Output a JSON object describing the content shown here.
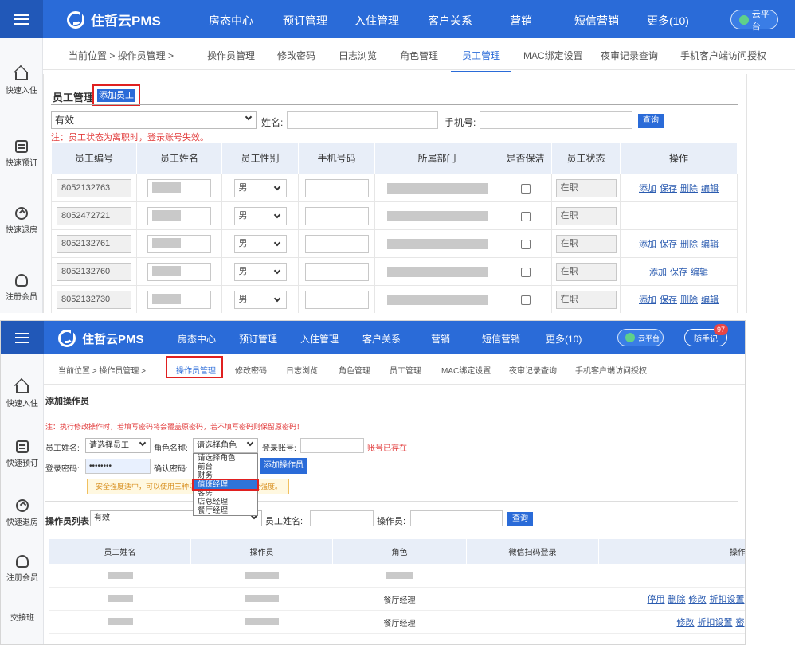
{
  "brand": "住哲云PMS",
  "shot1": {
    "nav": [
      "房态中心",
      "预订管理",
      "入住管理",
      "客户关系",
      "营销",
      "短信营销",
      "更多(10)"
    ],
    "cloud": "云平台",
    "sidebar": [
      "快速入住",
      "快速预订",
      "快速退房",
      "注册会员"
    ],
    "crumb": "当前位置 > 操作员管理 >",
    "tabs": [
      "操作员管理",
      "修改密码",
      "日志浏览",
      "角色管理",
      "员工管理",
      "MAC绑定设置",
      "夜审记录查询",
      "手机客户端访问授权"
    ],
    "section_title": "员工管理",
    "add_button": "添加员工",
    "status_select": "有效",
    "name_label": "姓名:",
    "phone_label": "手机号:",
    "query": "查询",
    "warning": "注：员工状态为离职时，登录账号失效。",
    "headers": [
      "员工编号",
      "员工姓名",
      "员工性别",
      "手机号码",
      "所属部门",
      "是否保洁",
      "员工状态",
      "操作"
    ],
    "rows": [
      {
        "id": "8052132763",
        "gender": "男",
        "status": "在职",
        "ops": [
          "添加",
          "保存",
          "删除",
          "编辑"
        ]
      },
      {
        "id": "8052472721",
        "gender": "男",
        "status": "在职",
        "ops": []
      },
      {
        "id": "8052132761",
        "gender": "男",
        "status": "在职",
        "ops": [
          "添加",
          "保存",
          "删除",
          "编辑"
        ]
      },
      {
        "id": "8052132760",
        "gender": "男",
        "status": "在职",
        "ops": [
          "添加",
          "保存",
          "编辑"
        ]
      },
      {
        "id": "8052132730",
        "gender": "男",
        "status": "在职",
        "ops": [
          "添加",
          "保存",
          "删除",
          "编辑"
        ]
      }
    ]
  },
  "shot2": {
    "nav": [
      "房态中心",
      "预订管理",
      "入住管理",
      "客户关系",
      "营销",
      "短信营销",
      "更多(10)"
    ],
    "cloud": "云平台",
    "note": "随手记",
    "badge": "97",
    "sidebar": [
      "快速入住",
      "快速预订",
      "快速退房",
      "注册会员",
      "交接班"
    ],
    "crumb": "当前位置 > 操作员管理 >",
    "tabs": [
      "操作员管理",
      "修改密码",
      "日志浏览",
      "角色管理",
      "员工管理",
      "MAC绑定设置",
      "夜审记录查询",
      "手机客户端访问授权"
    ],
    "section_title": "添加操作员",
    "note_line": "注：执行修改操作时，若填写密码将会覆盖原密码，若不填写密码则保留原密码！",
    "staff_label": "员工姓名:",
    "staff_select": "请选择员工",
    "role_label": "角色名称:",
    "role_select": "请选择角色",
    "account_label": "登录账号:",
    "account_exists": "账号已存在",
    "password_label": "登录密码:",
    "password_value": "••••••••",
    "confirm_label": "确认密码:",
    "add_button": "添加操作员",
    "hint_left": "安全强度适中，可以使用三种以",
    "hint_right": "全强度。",
    "role_options": [
      "请选择角色",
      "前台",
      "财务",
      "值班经理",
      "客房",
      "店总经理",
      "餐厅经理"
    ],
    "highlight_option": "值班经理",
    "list_label": "操作员列表",
    "list_status": "有效",
    "list_name_label": "员工姓名:",
    "list_operator_label": "操作员:",
    "query": "查询",
    "headers": [
      "员工姓名",
      "操作员",
      "角色",
      "微信扫码登录",
      "操作"
    ],
    "rows": [
      {
        "role": "",
        "ops": []
      },
      {
        "role": "餐厅经理",
        "ops": [
          "停用",
          "删除",
          "修改",
          "折扣设置"
        ]
      },
      {
        "role": "餐厅经理",
        "ops": [
          "修改",
          "折扣设置",
          "密"
        ]
      }
    ]
  }
}
